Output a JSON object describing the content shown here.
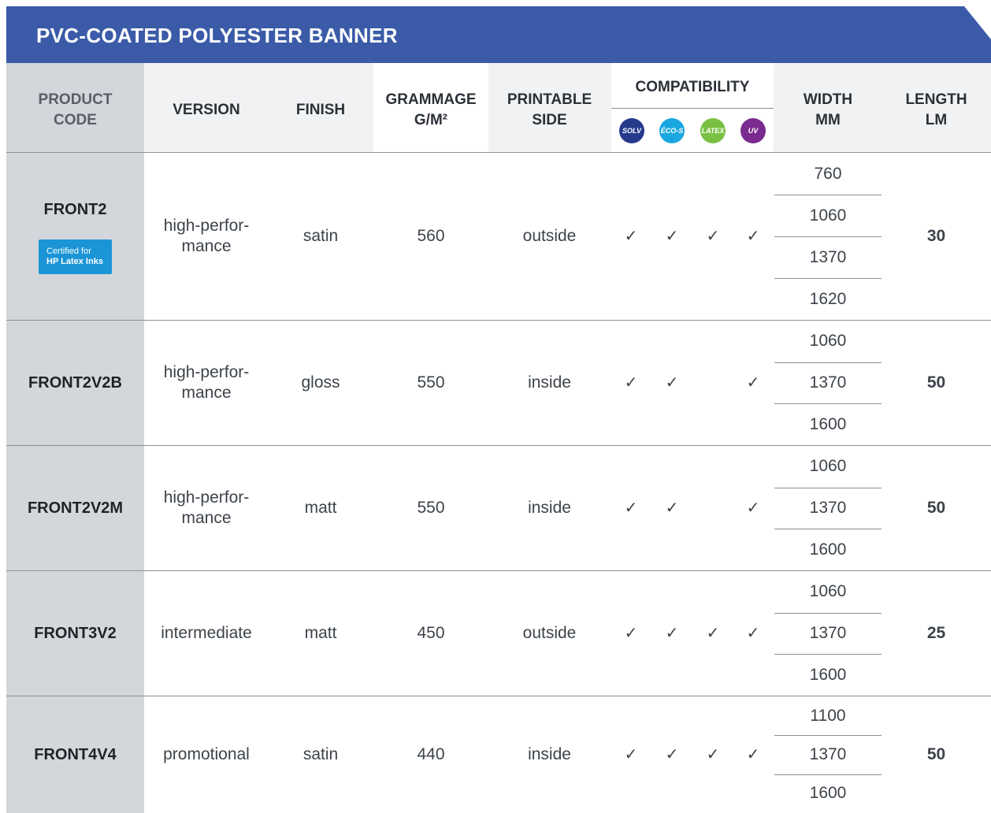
{
  "title": "PVC-COATED POLYESTER BANNER",
  "headers": {
    "product_code": "PRODUCT\nCODE",
    "version": "VERSION",
    "finish": "FINISH",
    "grammage": "GRAMMAGE\nG/M²",
    "printable_side": "PRINTABLE\nSIDE",
    "compatibility": "COMPATIBILITY",
    "width": "WIDTH\nMM",
    "length": "LENGTH\nLM"
  },
  "inks": [
    {
      "label": "SOLV",
      "color": "#263a8c"
    },
    {
      "label": "ÉCO-S",
      "color": "#1aa7e0"
    },
    {
      "label": "LATEX",
      "color": "#7ac143"
    },
    {
      "label": "UV",
      "color": "#7b2a8f"
    }
  ],
  "badge": {
    "line1": "Certified for",
    "line2": "HP Latex Inks"
  },
  "check_glyph": "✓",
  "rows": [
    {
      "code": "FRONT2",
      "version": "high-perfor-\nmance",
      "finish": "satin",
      "grammage": "560",
      "side": "outside",
      "compat": [
        true,
        true,
        true,
        true
      ],
      "widths": [
        "760",
        "1060",
        "1370",
        "1620"
      ],
      "length": "30"
    },
    {
      "code": "FRONT2V2B",
      "version": "high-perfor-\nmance",
      "finish": "gloss",
      "grammage": "550",
      "side": "inside",
      "compat": [
        true,
        true,
        false,
        true
      ],
      "widths": [
        "1060",
        "1370",
        "1600"
      ],
      "length": "50"
    },
    {
      "code": "FRONT2V2M",
      "version": "high-perfor-\nmance",
      "finish": "matt",
      "grammage": "550",
      "side": "inside",
      "compat": [
        true,
        true,
        false,
        true
      ],
      "widths": [
        "1060",
        "1370",
        "1600"
      ],
      "length": "50"
    },
    {
      "code": "FRONT3V2",
      "version": "intermediate",
      "finish": "matt",
      "grammage": "450",
      "side": "outside",
      "compat": [
        true,
        true,
        true,
        true
      ],
      "widths": [
        "1060",
        "1370",
        "1600"
      ],
      "length": "25"
    },
    {
      "code": "FRONT4V4",
      "version": "promotional",
      "finish": "satin",
      "grammage": "440",
      "side": "inside",
      "compat": [
        true,
        true,
        true,
        true
      ],
      "widths": [
        "1100",
        "1370",
        "1600"
      ],
      "length": "50"
    }
  ]
}
